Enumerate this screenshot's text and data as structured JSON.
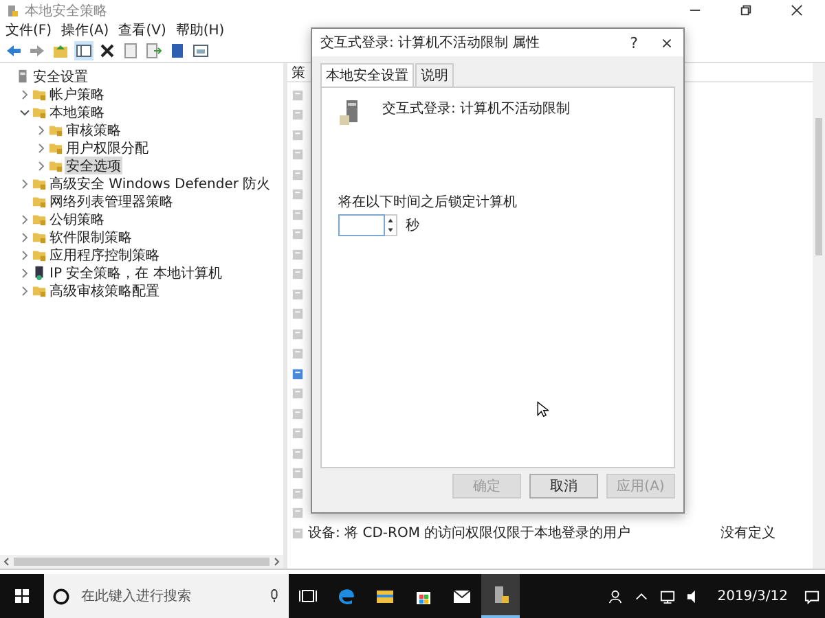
{
  "window": {
    "title": "本地安全策略"
  },
  "menu": [
    "文件(F)",
    "操作(A)",
    "查看(V)",
    "帮助(H)"
  ],
  "tree": [
    {
      "label": "安全设置",
      "kind": "root",
      "selected": false,
      "children": [
        {
          "label": "帐户策略",
          "kind": "folder",
          "expandable": true,
          "selected": false
        },
        {
          "label": "本地策略",
          "kind": "folder",
          "expanded": true,
          "selected": false,
          "children": [
            {
              "label": "审核策略",
              "kind": "folder",
              "expandable": true,
              "selected": false
            },
            {
              "label": "用户权限分配",
              "kind": "folder",
              "expandable": true,
              "selected": false
            },
            {
              "label": "安全选项",
              "kind": "folder",
              "expandable": true,
              "selected": true
            }
          ]
        },
        {
          "label": "高级安全 Windows Defender 防火",
          "kind": "folder",
          "expandable": true,
          "selected": false
        },
        {
          "label": "网络列表管理器策略",
          "kind": "folder",
          "expandable": false,
          "selected": false
        },
        {
          "label": "公钥策略",
          "kind": "folder",
          "expandable": true,
          "selected": false
        },
        {
          "label": "软件限制策略",
          "kind": "folder",
          "expandable": true,
          "selected": false
        },
        {
          "label": "应用程序控制策略",
          "kind": "folder",
          "expandable": true,
          "selected": false
        },
        {
          "label": "IP 安全策略，在 本地计算机",
          "kind": "ip",
          "expandable": true,
          "selected": false
        },
        {
          "label": "高级审核策略配置",
          "kind": "folder",
          "expandable": true,
          "selected": false
        }
      ]
    }
  ],
  "list": {
    "column_1": "策",
    "rows": [
      {
        "selected": false
      },
      {
        "selected": false
      },
      {
        "selected": false
      },
      {
        "selected": false
      },
      {
        "selected": false
      },
      {
        "selected": false
      },
      {
        "selected": false
      },
      {
        "selected": false
      },
      {
        "selected": false
      },
      {
        "selected": false
      },
      {
        "selected": false
      },
      {
        "selected": false
      },
      {
        "selected": false
      },
      {
        "selected": false
      },
      {
        "selected": true
      },
      {
        "selected": false
      },
      {
        "selected": false
      },
      {
        "selected": false
      },
      {
        "selected": false
      },
      {
        "selected": false
      },
      {
        "selected": false
      },
      {
        "selected": false
      },
      {
        "selected": false,
        "policy": "设备: 将 CD-ROM 的访问权限仅限于本地登录的用户",
        "setting": "没有定义"
      }
    ]
  },
  "dialog": {
    "title": "交互式登录: 计算机不活动限制 属性",
    "help": "?",
    "close": "×",
    "tabs": [
      {
        "label": "本地安全设置",
        "selected": true
      },
      {
        "label": "说明",
        "selected": false
      }
    ],
    "policy_name": "交互式登录: 计算机不活动限制",
    "field_label": "将在以下时间之后锁定计算机",
    "unit": "秒",
    "buttons": [
      {
        "label": "确定",
        "disabled": true
      },
      {
        "label": "取消",
        "disabled": false
      },
      {
        "label": "应用(A)",
        "disabled": true
      }
    ]
  },
  "taskbar": {
    "search_placeholder": "在此键入进行搜索",
    "apps": [
      {
        "kind": "taskview",
        "active": false
      },
      {
        "kind": "edge",
        "active": false
      },
      {
        "kind": "explorer",
        "active": false
      },
      {
        "kind": "store",
        "active": false
      },
      {
        "kind": "mail",
        "active": false
      },
      {
        "kind": "secpol",
        "active": true
      }
    ],
    "date": "2019/3/12"
  }
}
